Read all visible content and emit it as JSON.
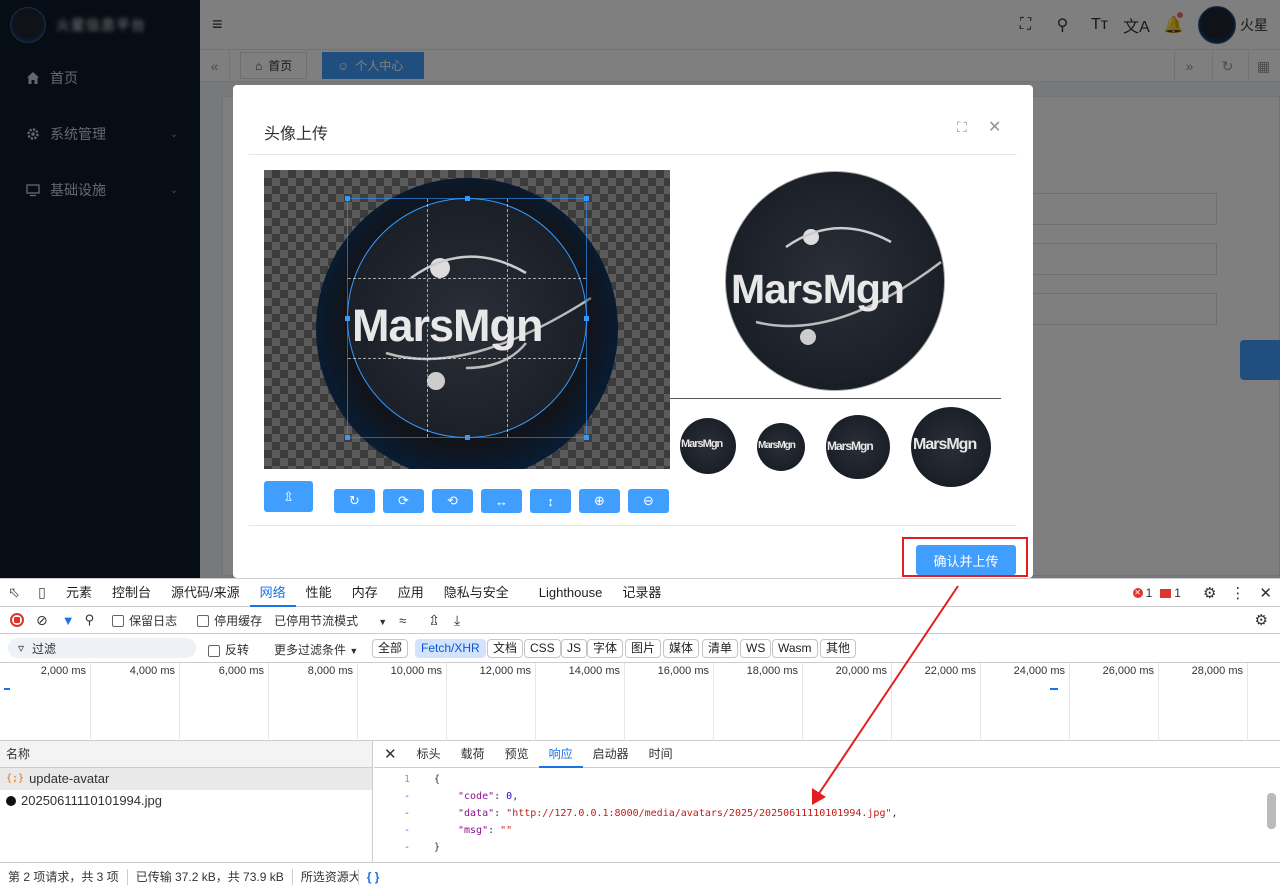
{
  "sidebar": {
    "app_title": "火星信息平台",
    "items": [
      {
        "label": "首页",
        "icon": "home-icon"
      },
      {
        "label": "系统管理",
        "icon": "gear-icon"
      },
      {
        "label": "基础设施",
        "icon": "monitor-icon"
      }
    ]
  },
  "header": {
    "user_name": "火星"
  },
  "tags": [
    {
      "label": "首页",
      "icon": "home-icon"
    },
    {
      "label": "个人中心",
      "icon": "user-icon"
    }
  ],
  "dialog": {
    "title": "头像上传",
    "logo_text": "MarsMgn",
    "confirm_label": "确认并上传"
  },
  "devtools": {
    "tabs": [
      "元素",
      "控制台",
      "源代码/来源",
      "网络",
      "性能",
      "内存",
      "应用",
      "隐私与安全",
      "Lighthouse",
      "记录器"
    ],
    "active_tab": "网络",
    "error_count": "1",
    "issue_count": "1",
    "toolbar": {
      "preserve_log": "保留日志",
      "disable_cache": "停用缓存",
      "throttle": "已停用节流模式"
    },
    "filter": {
      "placeholder": "过滤",
      "invert": "反转",
      "more_filters": "更多过滤条件",
      "chips": [
        "全部",
        "Fetch/XHR",
        "文档",
        "CSS",
        "JS",
        "字体",
        "图片",
        "媒体",
        "清单",
        "WS",
        "Wasm",
        "其他"
      ],
      "active_chip": "Fetch/XHR"
    },
    "timeline_labels": [
      "2,000 ms",
      "4,000 ms",
      "6,000 ms",
      "8,000 ms",
      "10,000 ms",
      "12,000 ms",
      "14,000 ms",
      "16,000 ms",
      "18,000 ms",
      "20,000 ms",
      "22,000 ms",
      "24,000 ms",
      "26,000 ms",
      "28,000 ms"
    ],
    "request_list": {
      "header": "名称",
      "rows": [
        {
          "name": "update-avatar",
          "type": "xhr"
        },
        {
          "name": "20250611110101994.jpg",
          "type": "img"
        }
      ]
    },
    "detail_tabs": [
      "标头",
      "载荷",
      "预览",
      "响应",
      "启动器",
      "时间"
    ],
    "active_detail_tab": "响应",
    "response": {
      "line1_num": "1",
      "open_brace": "{",
      "code_key": "\"code\"",
      "code_val": "0",
      "data_key": "\"data\"",
      "data_val": "\"http://127.0.0.1:8000/media/avatars/2025/20250611110101994.jpg\"",
      "msg_key": "\"msg\"",
      "msg_val": "\"\"",
      "close_brace": "}",
      "dash": "-"
    },
    "status": {
      "requests": "第 2 项请求，共 3 项",
      "transferred": "已传输 37.2 kB，共 73.9 kB",
      "resources": "所选资源大",
      "format": "{ }"
    }
  }
}
